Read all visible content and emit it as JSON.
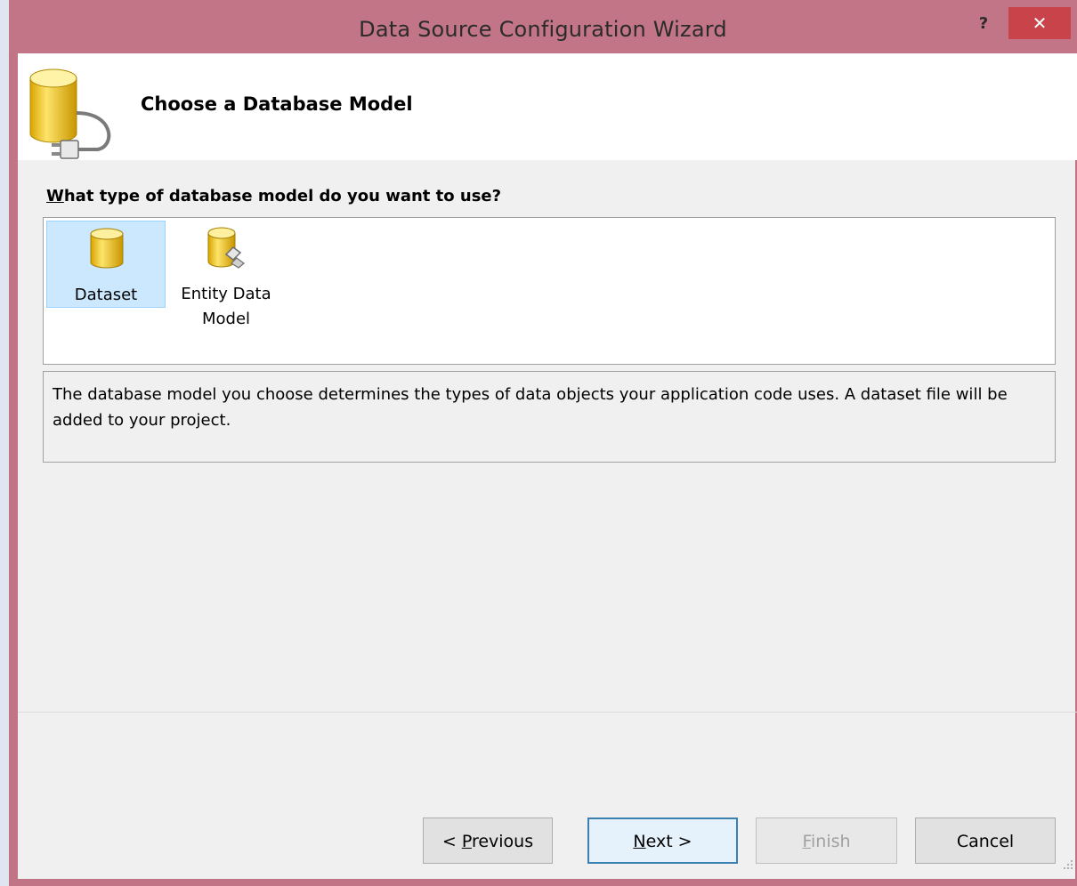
{
  "window": {
    "title": "Data Source Configuration Wizard",
    "help_label": "?",
    "close_label": "✕"
  },
  "header": {
    "title": "Choose a Database Model",
    "icon": "database-plug-icon"
  },
  "question": {
    "accesskey": "W",
    "rest": "hat type of database model do you want to use?"
  },
  "models": [
    {
      "label": "Dataset",
      "icon": "dataset-cylinder-icon",
      "selected": true
    },
    {
      "label_line1": "Entity Data",
      "label_line2": "Model",
      "icon": "entity-data-model-icon",
      "selected": false
    }
  ],
  "description": "The database model you choose determines the types of data objects your application code uses. A dataset file will be added to your project.",
  "buttons": {
    "previous": {
      "prefix": "< ",
      "accesskey": "P",
      "rest": "revious"
    },
    "next": {
      "accesskey": "N",
      "rest": "ext >"
    },
    "finish": {
      "accesskey": "F",
      "rest": "inish",
      "enabled": false
    },
    "cancel": {
      "label": "Cancel"
    }
  },
  "colors": {
    "titlebar": "#c27587",
    "close_button": "#c8434a",
    "selection": "#cce8ff",
    "default_button_border": "#3c7fb1"
  }
}
